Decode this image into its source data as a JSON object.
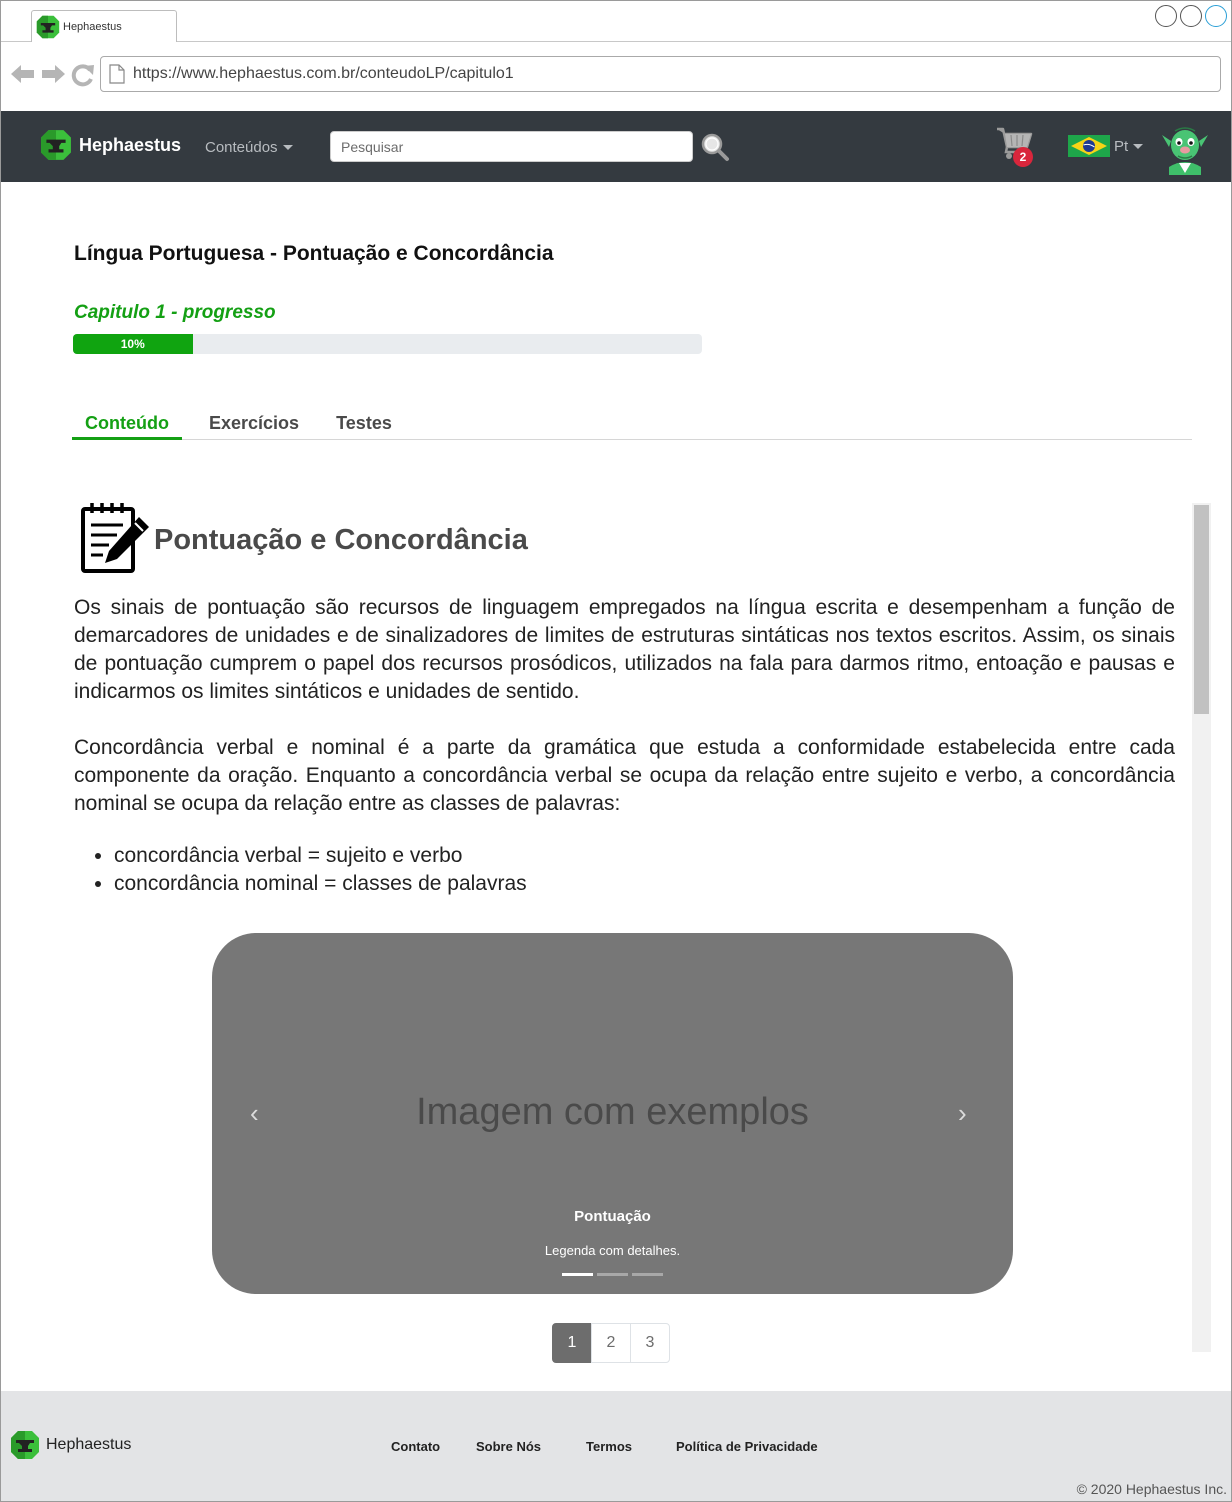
{
  "browser": {
    "tab_title": "Hephaestus",
    "url": "https://www.hephaestus.com.br/conteudoLP/capitulo1"
  },
  "navbar": {
    "brand": "Hephaestus",
    "menu_label": "Conteúdos",
    "search_placeholder": "Pesquisar",
    "cart_count": "2",
    "language": "Pt",
    "icons": [
      "anvil-logo-icon",
      "search-icon",
      "cart-icon",
      "brazil-flag-icon",
      "goblin-avatar-icon"
    ]
  },
  "course": {
    "title": "Língua Portuguesa - Pontuação e Concordância",
    "progress_label": "Capitulo 1 - progresso",
    "progress_text": "10%",
    "progress_value": 0.1
  },
  "tabs": [
    {
      "label": "Conteúdo",
      "active": true
    },
    {
      "label": "Exercícios",
      "active": false
    },
    {
      "label": "Testes",
      "active": false
    }
  ],
  "content": {
    "section_title": "Pontuação e Concordância",
    "paragraph1": "Os sinais de pontuação são recursos de linguagem empregados na língua escrita e desempenham a função de demarcadores de unidades e de sinalizadores de limites de estruturas sintáticas nos textos escritos. Assim, os sinais de pontuação cumprem o papel dos recursos prosódicos, utilizados na fala para darmos ritmo, entoação e pausas e indicarmos os limites sintáticos e unidades de sentido.",
    "paragraph2": "Concordância verbal e nominal é a parte da gramática que estuda a conformidade estabelecida entre cada componente da oração. Enquanto a concordância verbal se ocupa da relação entre sujeito e verbo, a concordância nominal se ocupa da relação entre as classes de palavras:",
    "bullets": [
      "concordância verbal = sujeito e verbo",
      "concordância nominal = classes de palavras"
    ]
  },
  "carousel": {
    "image_text": "Imagem com exemplos",
    "caption_title": "Pontuação",
    "caption_text": "Legenda com detalhes.",
    "prev": "‹",
    "next": "›",
    "slides": 3,
    "active_slide": 1
  },
  "pagination": [
    "1",
    "2",
    "3"
  ],
  "footer": {
    "brand": "Hephaestus",
    "links": [
      "Contato",
      "Sobre Nós",
      "Termos",
      "Política de Privacidade"
    ],
    "copyright": "© 2020 Hephaestus Inc."
  },
  "colors": {
    "navbar_bg": "#343a40",
    "accent_green": "#14a014",
    "badge_red": "#d9263c",
    "footer_bg": "#e3e4e6"
  }
}
